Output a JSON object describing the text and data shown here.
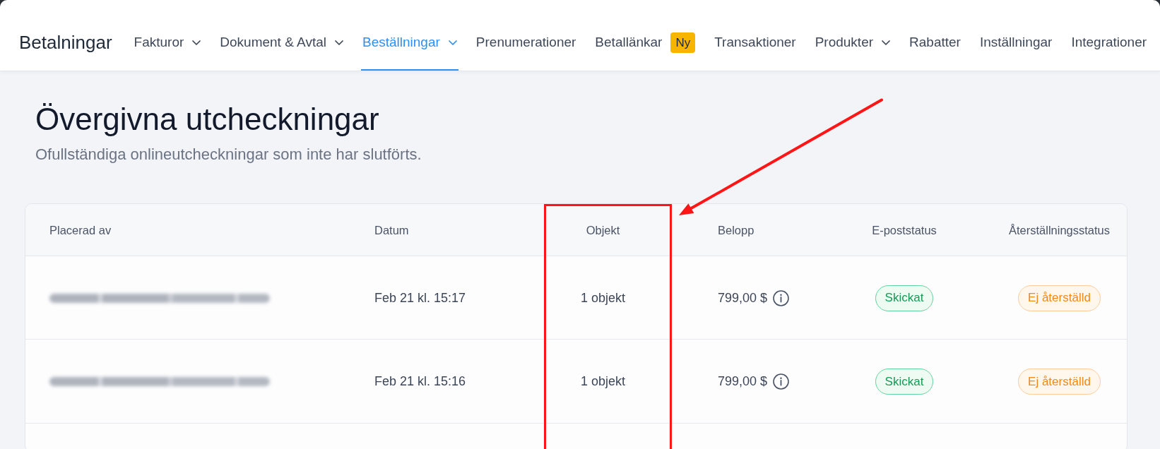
{
  "navbar": {
    "brand": "Betalningar",
    "items": [
      {
        "label": "Fakturor",
        "dropdown": true,
        "selected": false
      },
      {
        "label": "Dokument & Avtal",
        "dropdown": true,
        "selected": false
      },
      {
        "label": "Beställningar",
        "dropdown": true,
        "selected": true
      },
      {
        "label": "Prenumerationer",
        "dropdown": false,
        "selected": false
      },
      {
        "label": "Betallänkar",
        "dropdown": false,
        "selected": false,
        "badge": "Ny"
      },
      {
        "label": "Transaktioner",
        "dropdown": false,
        "selected": false
      },
      {
        "label": "Produkter",
        "dropdown": true,
        "selected": false
      },
      {
        "label": "Rabatter",
        "dropdown": false,
        "selected": false
      },
      {
        "label": "Inställningar",
        "dropdown": false,
        "selected": false
      },
      {
        "label": "Integrationer",
        "dropdown": false,
        "selected": false
      }
    ]
  },
  "page": {
    "title": "Övergivna utcheckningar",
    "subtitle": "Ofullständiga onlineutcheckningar som inte har slutförts."
  },
  "table": {
    "columns": [
      {
        "label": "Placerad av",
        "highlighted": false
      },
      {
        "label": "Datum",
        "highlighted": false
      },
      {
        "label": "Objekt",
        "highlighted": true
      },
      {
        "label": "Belopp",
        "highlighted": false
      },
      {
        "label": "E-poststatus",
        "highlighted": false
      },
      {
        "label": "Återställningsstatus",
        "highlighted": false
      }
    ],
    "rows": [
      {
        "placed_by_blurred": true,
        "date": "Feb 21 kl. 15:17",
        "items": "1 objekt",
        "amount": "799,00 $",
        "amount_info": true,
        "email_status": {
          "label": "Skickat",
          "kind": "success"
        },
        "recovery_status": {
          "label": "Ej återställd",
          "kind": "warning"
        }
      },
      {
        "placed_by_blurred": true,
        "date": "Feb 21 kl. 15:16",
        "items": "1 objekt",
        "amount": "799,00 $",
        "amount_info": true,
        "email_status": {
          "label": "Skickat",
          "kind": "success"
        },
        "recovery_status": {
          "label": "Ej återställd",
          "kind": "warning"
        }
      }
    ]
  },
  "annotation": {
    "arrow": true
  }
}
